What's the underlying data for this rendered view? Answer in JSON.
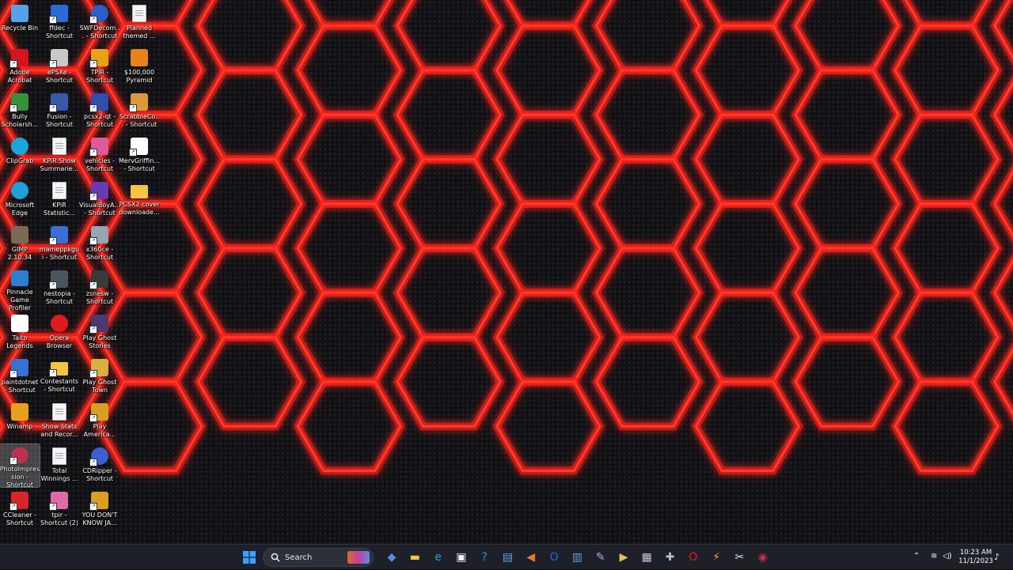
{
  "desktop": {
    "icons": [
      {
        "label": "Recycle Bin",
        "icon": "recycle-bin-icon",
        "color": "#5aa0e6",
        "shortcut": false,
        "col": 0,
        "row": 0
      },
      {
        "label": "ffdec - Shortcut",
        "icon": "ffdec-icon",
        "color": "#2c6bd6",
        "shortcut": true,
        "col": 1,
        "row": 0
      },
      {
        "label": "SWFDecom... - Shortcut",
        "icon": "swf-decompiler-icon",
        "color": "#2b5fc9",
        "shortcut": true,
        "col": 2,
        "row": 0
      },
      {
        "label": "Planned themed ...",
        "icon": "document-icon",
        "color": "#f4f4f4",
        "shortcut": false,
        "col": 3,
        "row": 0
      },
      {
        "label": "Adobe Acrobat",
        "icon": "adobe-acrobat-icon",
        "color": "#d3151d",
        "shortcut": true,
        "col": 0,
        "row": 1
      },
      {
        "label": "ePSXe - Shortcut",
        "icon": "epsxe-icon",
        "color": "#c9c9c9",
        "shortcut": true,
        "col": 1,
        "row": 1
      },
      {
        "label": "TPiR - Shortcut",
        "icon": "tpir-icon",
        "color": "#e8a21a",
        "shortcut": true,
        "col": 2,
        "row": 1
      },
      {
        "label": "$100,000 Pyramid",
        "icon": "pyramid-icon",
        "color": "#e8821a",
        "shortcut": false,
        "col": 3,
        "row": 1
      },
      {
        "label": "Bully Scholarsh...",
        "icon": "bully-icon",
        "color": "#3a8f3a",
        "shortcut": true,
        "col": 0,
        "row": 2
      },
      {
        "label": "Fusion - Shortcut",
        "icon": "fusion-icon",
        "color": "#3b57a8",
        "shortcut": true,
        "col": 1,
        "row": 2
      },
      {
        "label": "pcsx2-qt - Shortcut",
        "icon": "pcsx2-icon",
        "color": "#2f4fb0",
        "shortcut": true,
        "col": 2,
        "row": 2
      },
      {
        "label": "ScrabbleCo... - Shortcut",
        "icon": "scrabble-icon",
        "color": "#d99a3a",
        "shortcut": true,
        "col": 3,
        "row": 2
      },
      {
        "label": "ClipGrab",
        "icon": "clipgrab-icon",
        "color": "#1aa6d9",
        "shortcut": false,
        "col": 0,
        "row": 3
      },
      {
        "label": "KPiR Show Summarie...",
        "icon": "document-icon",
        "color": "#f4f4f4",
        "shortcut": false,
        "col": 1,
        "row": 3
      },
      {
        "label": "vehicles - Shortcut",
        "icon": "vehicles-icon",
        "color": "#e05a9a",
        "shortcut": true,
        "col": 2,
        "row": 3
      },
      {
        "label": "MervGriffin... - Shortcut",
        "icon": "mervgriffin-icon",
        "color": "#ffffff",
        "shortcut": true,
        "col": 3,
        "row": 3
      },
      {
        "label": "Microsoft Edge",
        "icon": "edge-icon",
        "color": "#1fa0d8",
        "shortcut": false,
        "col": 0,
        "row": 4
      },
      {
        "label": "KPiR Statistic...",
        "icon": "document-icon",
        "color": "#f4f4f4",
        "shortcut": false,
        "col": 1,
        "row": 4
      },
      {
        "label": "VisualBoyA... - Shortcut",
        "icon": "visualboy-icon",
        "color": "#6a3bb0",
        "shortcut": true,
        "col": 2,
        "row": 4
      },
      {
        "label": "PCSX2 cover downloade...",
        "icon": "folder-icon",
        "color": "#f5c542",
        "shortcut": false,
        "col": 3,
        "row": 4
      },
      {
        "label": "GIMP 2.10.34",
        "icon": "gimp-icon",
        "color": "#7a6a55",
        "shortcut": false,
        "col": 0,
        "row": 5
      },
      {
        "label": "mameppkgui - Shortcut",
        "icon": "mame-icon",
        "color": "#3a6fd6",
        "shortcut": true,
        "col": 1,
        "row": 5
      },
      {
        "label": "x360ce - Shortcut",
        "icon": "x360ce-icon",
        "color": "#9aa4b0",
        "shortcut": true,
        "col": 2,
        "row": 5
      },
      {
        "label": "Pinnacle Game Profiler",
        "icon": "pinnacle-icon",
        "color": "#2f7fd0",
        "shortcut": false,
        "col": 0,
        "row": 6
      },
      {
        "label": "nestopia - Shortcut",
        "icon": "nestopia-icon",
        "color": "#4a5560",
        "shortcut": true,
        "col": 1,
        "row": 6
      },
      {
        "label": "zsnesw - Shortcut",
        "icon": "zsnes-icon",
        "color": "#3a3a3a",
        "shortcut": true,
        "col": 2,
        "row": 6
      },
      {
        "label": "Taito Legends",
        "icon": "taito-invader-icon",
        "color": "#ffffff",
        "shortcut": false,
        "col": 0,
        "row": 7
      },
      {
        "label": "Opera Browser",
        "icon": "opera-icon",
        "color": "#e21a1a",
        "shortcut": false,
        "col": 1,
        "row": 7
      },
      {
        "label": "Play Ghost Stories",
        "icon": "ghost-stories-icon",
        "color": "#4a3a70",
        "shortcut": true,
        "col": 2,
        "row": 7
      },
      {
        "label": "paintdotnet - Shortcut",
        "icon": "paintdotnet-icon",
        "color": "#3b6fd6",
        "shortcut": true,
        "col": 0,
        "row": 8
      },
      {
        "label": "Contestants - Shortcut",
        "icon": "folder-icon",
        "color": "#f5c542",
        "shortcut": true,
        "col": 1,
        "row": 8
      },
      {
        "label": "Play Ghost Town",
        "icon": "ghost-town-icon",
        "color": "#d9b040",
        "shortcut": true,
        "col": 2,
        "row": 8
      },
      {
        "label": "Winamp",
        "icon": "winamp-icon",
        "color": "#e8a020",
        "shortcut": false,
        "col": 0,
        "row": 9
      },
      {
        "label": "Show Stats and Recor...",
        "icon": "document-icon",
        "color": "#f4f4f4",
        "shortcut": false,
        "col": 1,
        "row": 9
      },
      {
        "label": "Play America...",
        "icon": "star-icon",
        "color": "#d9a020",
        "shortcut": true,
        "col": 2,
        "row": 9
      },
      {
        "label": "PhotoImpression - Shortcut",
        "icon": "photoimpression-icon",
        "color": "#c03050",
        "shortcut": true,
        "col": 0,
        "row": 10,
        "selected": true
      },
      {
        "label": "Total Winnings ...",
        "icon": "document-icon",
        "color": "#f4f4f4",
        "shortcut": false,
        "col": 1,
        "row": 10
      },
      {
        "label": "CDRipper - Shortcut",
        "icon": "cdripper-icon",
        "color": "#3a5fd0",
        "shortcut": true,
        "col": 2,
        "row": 10
      },
      {
        "label": "CCleaner - Shortcut",
        "icon": "ccleaner-icon",
        "color": "#d8242a",
        "shortcut": true,
        "col": 0,
        "row": 11
      },
      {
        "label": "tpir - Shortcut (2)",
        "icon": "tpir2-icon",
        "color": "#e06aa8",
        "shortcut": true,
        "col": 1,
        "row": 11
      },
      {
        "label": "YOU DON'T KNOW JA...",
        "icon": "ydkj-icon",
        "color": "#d9a020",
        "shortcut": true,
        "col": 2,
        "row": 11
      }
    ]
  },
  "taskbar": {
    "search_placeholder": "Search",
    "apps": [
      {
        "name": "copilot-icon",
        "color": "#5a8be0",
        "glyph": "◆"
      },
      {
        "name": "file-explorer-icon",
        "color": "#f5c542",
        "glyph": "▬"
      },
      {
        "name": "edge-icon",
        "color": "#1fa0d8",
        "glyph": "e"
      },
      {
        "name": "microsoft-store-icon",
        "color": "#f2f2f2",
        "glyph": "▣"
      },
      {
        "name": "help-icon",
        "color": "#2f8fe6",
        "glyph": "?"
      },
      {
        "name": "photos-icon",
        "color": "#58a8e8",
        "glyph": "▤"
      },
      {
        "name": "media-player-icon",
        "color": "#e8782a",
        "glyph": "◀"
      },
      {
        "name": "outlook-icon",
        "color": "#1a6fd0",
        "glyph": "O"
      },
      {
        "name": "notepad-icon",
        "color": "#5aa0e6",
        "glyph": "▥"
      },
      {
        "name": "paint-icon",
        "color": "#9ab0d8",
        "glyph": "✎"
      },
      {
        "name": "video-player-icon",
        "color": "#e8c060",
        "glyph": "▶"
      },
      {
        "name": "calculator-icon",
        "color": "#c8c8d0",
        "glyph": "▦"
      },
      {
        "name": "gamepad-icon",
        "color": "#b8c0cc",
        "glyph": "✚"
      },
      {
        "name": "opera-icon",
        "color": "#e21a1a",
        "glyph": "O"
      },
      {
        "name": "winamp-icon",
        "color": "#e8a020",
        "glyph": "⚡"
      },
      {
        "name": "snipping-tool-icon",
        "color": "#e8e8e8",
        "glyph": "✂"
      },
      {
        "name": "photoimpression-icon",
        "color": "#c03050",
        "glyph": "◉"
      }
    ],
    "clock": {
      "time": "10:23 AM",
      "date": "11/1/2023"
    }
  },
  "colors": {
    "hex_glow": "#ff1a1a",
    "hex_core": "#ff3a2a",
    "hex_fill": "#111114",
    "taskbar_bg": "#1d2029",
    "start_blue": "#3aa0ff"
  }
}
